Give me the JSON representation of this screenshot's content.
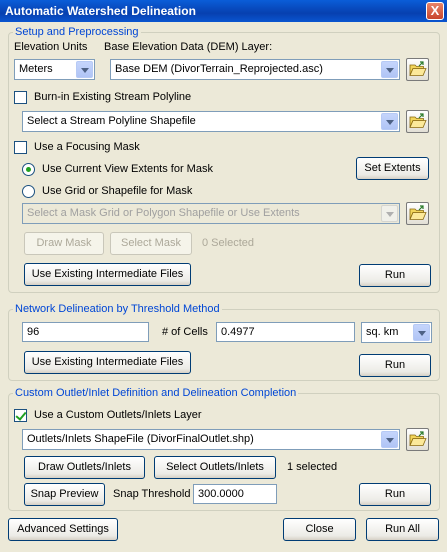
{
  "window": {
    "title": "Automatic Watershed Delineation",
    "close_glyph": "X"
  },
  "setup": {
    "legend": "Setup and Preprocessing",
    "elevation_units_label": "Elevation Units",
    "dem_label": "Base Elevation Data (DEM) Layer:",
    "elevation_units_value": "Meters",
    "dem_value": "Base DEM (DivorTerrain_Reprojected.asc)",
    "burn_in_label": "Burn-in Existing Stream Polyline",
    "burn_in_checked": false,
    "stream_value": "Select a Stream Polyline Shapefile",
    "focus_mask_label": "Use a Focusing Mask",
    "focus_mask_checked": false,
    "radio_view_label": "Use Current View Extents for Mask",
    "radio_grid_label": "Use Grid or Shapefile for Mask",
    "set_extents_label": "Set Extents",
    "mask_value": "Select a Mask Grid or Polygon Shapefile or Use Extents",
    "draw_mask_label": "Draw Mask",
    "select_mask_label": "Select Mask",
    "selected_count": "0 Selected",
    "use_existing_label": "Use Existing Intermediate Files",
    "run_label": "Run"
  },
  "network": {
    "legend": "Network Delineation by Threshold Method",
    "threshold_value": "96",
    "cells_label": "# of Cells",
    "area_value": "0.4977",
    "unit_value": "sq. km",
    "use_existing_label": "Use Existing Intermediate Files",
    "run_label": "Run"
  },
  "outlet": {
    "legend": "Custom Outlet/Inlet Definition and Delineation Completion",
    "custom_layer_label": "Use a Custom Outlets/Inlets Layer",
    "custom_layer_checked": true,
    "outlet_value": "Outlets/Inlets ShapeFile (DivorFinalOutlet.shp)",
    "draw_label": "Draw Outlets/Inlets",
    "select_label": "Select Outlets/Inlets",
    "selected_text": "1 selected",
    "snap_preview_label": "Snap Preview",
    "snap_threshold_label": "Snap Threshold",
    "snap_threshold_value": "300.0000",
    "run_label": "Run"
  },
  "footer": {
    "advanced_label": "Advanced Settings",
    "close_label": "Close",
    "run_all_label": "Run All"
  }
}
